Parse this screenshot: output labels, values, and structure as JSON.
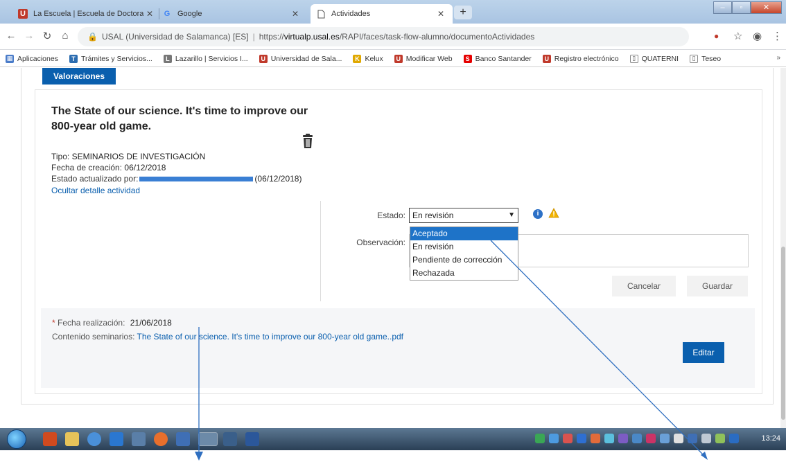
{
  "browser": {
    "tabs": [
      {
        "title": "La Escuela | Escuela de Doctorad",
        "close": "✕"
      },
      {
        "title": "Google",
        "close": "✕"
      },
      {
        "title": "Actividades",
        "close": "✕"
      }
    ],
    "new_tab": "+",
    "url": {
      "site": "USAL (Universidad de Salamanca) [ES]",
      "prefix": "https://",
      "host": "virtualp.usal.es",
      "path": "/RAPI/faces/task-flow-alumno/documentoActividades"
    },
    "bookmarks": [
      "Aplicaciones",
      "Trámites y Servicios...",
      "Lazarillo | Servicios I...",
      "Universidad de Sala...",
      "Kelux",
      "Modificar Web",
      "Banco Santander",
      "Registro electrónico",
      "QUATERNI",
      "Teseo"
    ],
    "bookmarks_more": "»"
  },
  "page": {
    "tab_label": "Valoraciones",
    "activity": {
      "title": "The State of our science. It's time to improve our 800-year old game.",
      "tipo_label": "Tipo:",
      "tipo_value": "SEMINARIOS DE INVESTIGACIÓN",
      "fecha_label": "Fecha de creación:",
      "fecha_value": "06/12/2018",
      "estado_label": "Estado actualizado por:",
      "estado_date": "(06/12/2018)",
      "toggle_link": "Ocultar detalle actividad"
    },
    "form": {
      "estado_label": "Estado:",
      "estado_value": "En revisión",
      "options": [
        "Aceptado",
        "En revisión",
        "Pendiente de corrección",
        "Rechazada"
      ],
      "highlighted_option": 0,
      "observacion_label": "Observación:",
      "cancel_label": "Cancelar",
      "save_label": "Guardar"
    },
    "details": {
      "required_mark": "*",
      "fecha_realizacion_label": "Fecha realización:",
      "fecha_realizacion_value": "21/06/2018",
      "contenido_label": "Contenido seminarios:",
      "contenido_link": "The State of our science. It's time to improve our 800-year old game..pdf",
      "edit_label": "Editar"
    }
  },
  "taskbar": {
    "clock": "13:24"
  },
  "colors": {
    "brand_blue": "#0a5fae",
    "dropdown_highlight": "#1e73c8",
    "redaction": "#3a7fd4",
    "annotation_line": "#2f6fc0"
  }
}
